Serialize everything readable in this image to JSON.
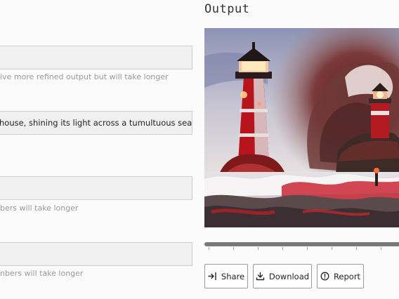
{
  "form": {
    "field1": {
      "value": "",
      "hint": "ive more refined output but will take longer"
    },
    "field2": {
      "value": "house, shining its light across a tumultuous sea of b"
    },
    "field3": {
      "value": "",
      "hint": "bers will take longer"
    },
    "field4": {
      "value": "",
      "hint": "nbers will take longer"
    }
  },
  "output": {
    "title": "Output",
    "progress": 1.0,
    "buttons": {
      "share": {
        "label": "Share",
        "icon": "share-icon"
      },
      "download": {
        "label": "Download",
        "icon": "download-icon"
      },
      "report": {
        "label": "Report",
        "icon": "report-icon"
      }
    }
  }
}
